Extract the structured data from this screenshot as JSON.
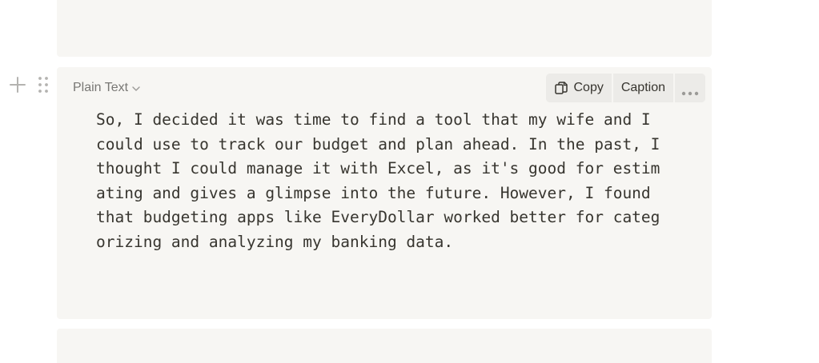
{
  "code_block": {
    "language_label": "Plain Text",
    "toolbar": {
      "copy_label": "Copy",
      "caption_label": "Caption"
    },
    "lines": [
      "So, I decided it was time to find a tool that my wife and I",
      "could use to track our budget and plan ahead. In the past, I",
      "thought I could manage it with Excel, as it's good for estim",
      "ating and gives a glimpse into the future. However, I found",
      "that budgeting apps like EveryDollar worked better for categ",
      "orizing and analyzing my banking data."
    ]
  },
  "colors": {
    "block_background": "#f7f6f3",
    "text": "#37352f",
    "muted_text": "#787774",
    "toolbar_background": "#ecebe8"
  },
  "icons": {
    "add": "plus-icon",
    "drag": "drag-handle-icon",
    "language_dropdown": "chevron-down-icon",
    "copy": "copy-icon",
    "more": "more-horizontal-icon"
  }
}
